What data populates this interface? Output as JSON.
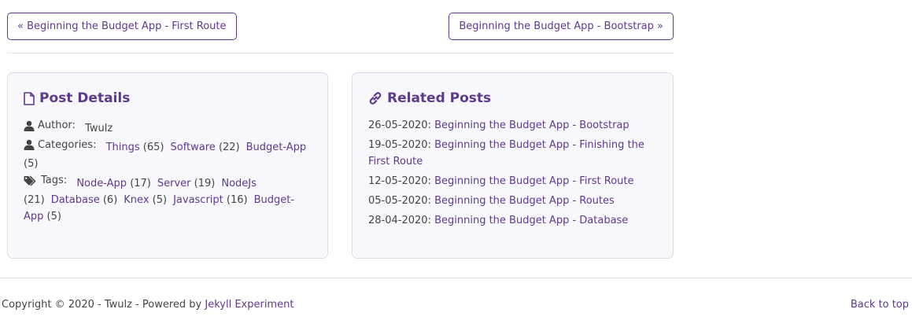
{
  "pager": {
    "prev_label": "« Beginning the Budget App - First Route",
    "next_label": "Beginning the Budget App - Bootstrap »"
  },
  "post_details": {
    "title": "Post Details",
    "author_label": "Author:",
    "author_value": "Twulz",
    "categories_label": "Categories:",
    "categories": [
      {
        "name": "Things",
        "count": "(65)"
      },
      {
        "name": "Software",
        "count": "(22)"
      },
      {
        "name": "Budget-App",
        "count": "(5)"
      }
    ],
    "tags_label": "Tags:",
    "tags": [
      {
        "name": "Node-App",
        "count": "(17)"
      },
      {
        "name": "Server",
        "count": "(19)"
      },
      {
        "name": "NodeJs",
        "count": "(21)"
      },
      {
        "name": "Database",
        "count": "(6)"
      },
      {
        "name": "Knex",
        "count": "(5)"
      },
      {
        "name": "Javascript",
        "count": "(16)"
      },
      {
        "name": "Budget-App",
        "count": "(5)"
      }
    ]
  },
  "related_posts": {
    "title": "Related Posts",
    "items": [
      {
        "date": "26-05-2020:",
        "title": "Beginning the Budget App - Bootstrap"
      },
      {
        "date": "19-05-2020:",
        "title": "Beginning the Budget App - Finishing the First Route"
      },
      {
        "date": "12-05-2020:",
        "title": "Beginning the Budget App - First Route"
      },
      {
        "date": "05-05-2020:",
        "title": "Beginning the Budget App - Routes"
      },
      {
        "date": "28-04-2020:",
        "title": "Beginning the Budget App - Database"
      }
    ]
  },
  "footer": {
    "copyright": "Copyright © 2020 - Twulz - Powered by",
    "powered_link": "Jekyll Experiment",
    "back_to_top": "Back to top"
  },
  "colors": {
    "accent": "#5e3a8c",
    "card_bg": "#f8f7fb",
    "text": "#444444"
  },
  "icons": {
    "post_details": "file-icon",
    "related_posts": "link-icon",
    "author": "user-icon",
    "categories": "user-icon",
    "tags": "tags-icon"
  }
}
